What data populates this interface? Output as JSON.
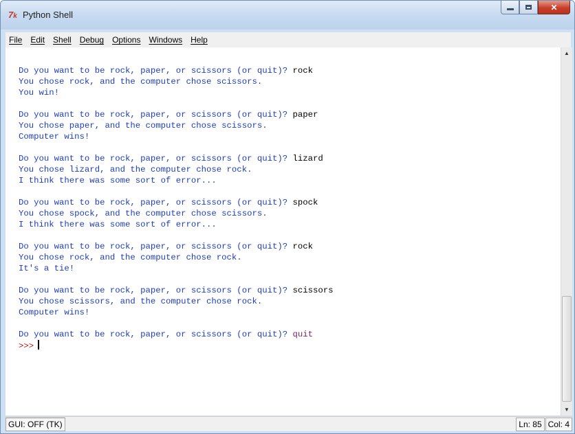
{
  "window": {
    "title": "Python Shell",
    "icon": "idle-icon",
    "controls": [
      "minimize-icon",
      "maximize-icon",
      "close-icon"
    ]
  },
  "menu": [
    "File",
    "Edit",
    "Shell",
    "Debug",
    "Options",
    "Windows",
    "Help"
  ],
  "transcript": [
    {
      "prompt": "Do you want to be rock, paper, or scissors (or quit)? ",
      "input": "rock"
    },
    {
      "out": "You chose rock, and the computer chose scissors."
    },
    {
      "out": "You win!"
    },
    {
      "blank": true
    },
    {
      "prompt": "Do you want to be rock, paper, or scissors (or quit)? ",
      "input": "paper"
    },
    {
      "out": "You chose paper, and the computer chose scissors."
    },
    {
      "out": "Computer wins!"
    },
    {
      "blank": true
    },
    {
      "prompt": "Do you want to be rock, paper, or scissors (or quit)? ",
      "input": "lizard"
    },
    {
      "out": "You chose lizard, and the computer chose rock."
    },
    {
      "out": "I think there was some sort of error..."
    },
    {
      "blank": true
    },
    {
      "prompt": "Do you want to be rock, paper, or scissors (or quit)? ",
      "input": "spock"
    },
    {
      "out": "You chose spock, and the computer chose scissors."
    },
    {
      "out": "I think there was some sort of error..."
    },
    {
      "blank": true
    },
    {
      "prompt": "Do you want to be rock, paper, or scissors (or quit)? ",
      "input": "rock"
    },
    {
      "out": "You chose rock, and the computer chose rock."
    },
    {
      "out": "It's a tie!"
    },
    {
      "blank": true
    },
    {
      "prompt": "Do you want to be rock, paper, or scissors (or quit)? ",
      "input": "scissors"
    },
    {
      "out": "You chose scissors, and the computer chose rock."
    },
    {
      "out": "Computer wins!"
    },
    {
      "blank": true
    },
    {
      "prompt": "Do you want to be rock, paper, or scissors (or quit)? ",
      "input": "quit",
      "input_style": "quit"
    },
    {
      "shell_prompt": ">>>"
    }
  ],
  "status": {
    "gui": "GUI: OFF (TK)",
    "line": "Ln: 85",
    "col": "Col: 4"
  },
  "colors": {
    "output": "#1f3dbb",
    "input": "#000000",
    "quit_input": "#7a1f6e",
    "shell_prompt": "#b01818"
  }
}
